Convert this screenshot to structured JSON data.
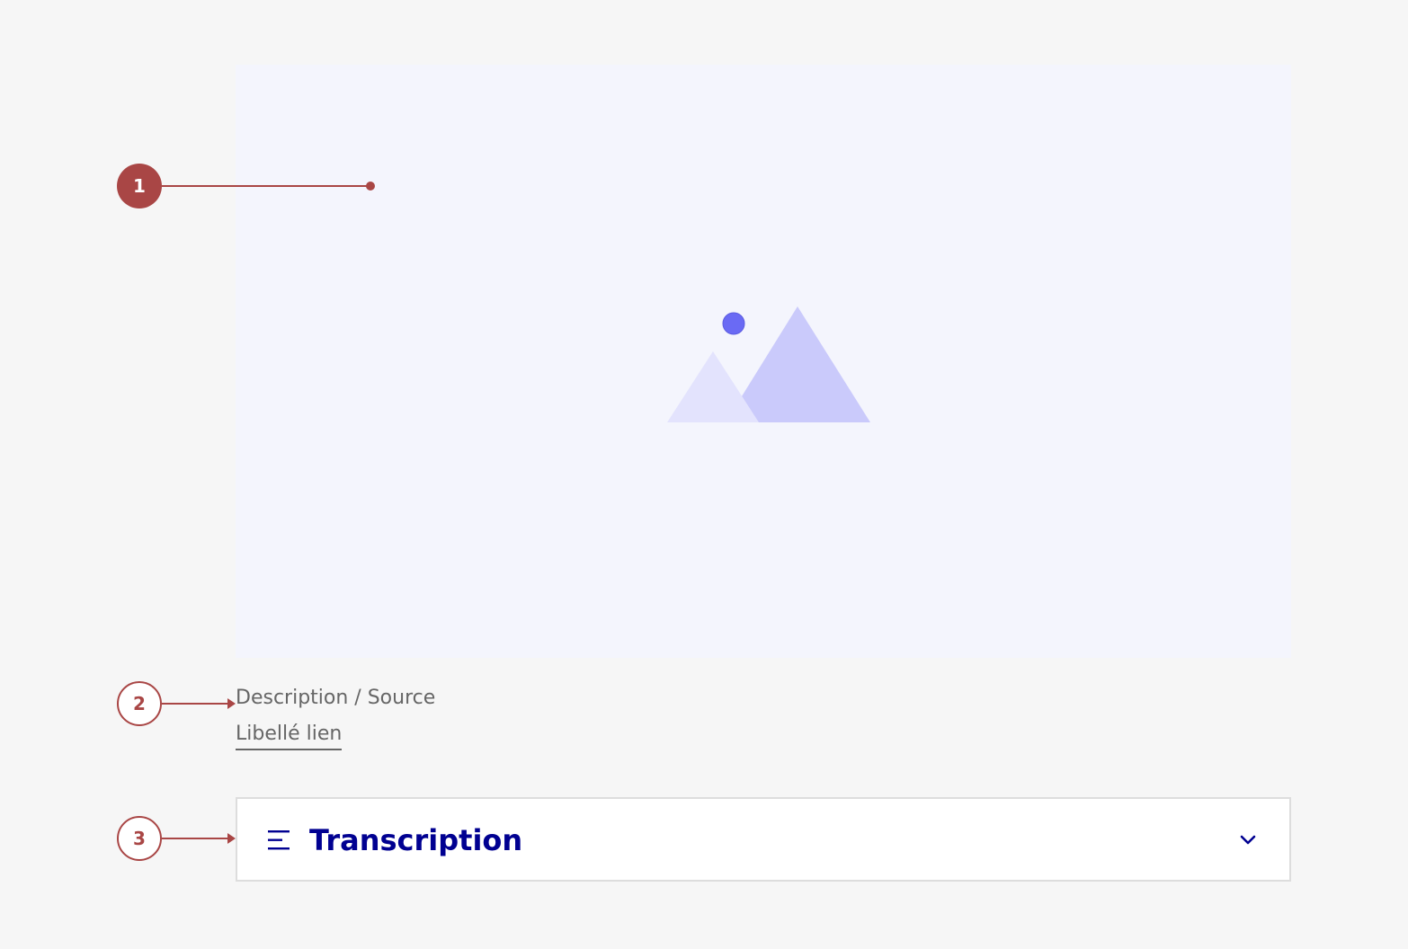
{
  "annotations": [
    {
      "number": "1",
      "style": "filled"
    },
    {
      "number": "2",
      "style": "outline"
    },
    {
      "number": "3",
      "style": "outline"
    }
  ],
  "media": {
    "placeholder_icon": "image-placeholder-icon",
    "background_color": "#f4f5fd",
    "sun_color": "#6a6af4",
    "mountain_front_color": "#cacafb",
    "mountain_back_color": "#e3e3fd"
  },
  "caption": {
    "text": "Description / Source",
    "link_label": "Libellé lien"
  },
  "transcription": {
    "icon": "list-icon",
    "title": "Transcription",
    "toggle_icon": "chevron-down-icon",
    "expanded": false
  },
  "colors": {
    "annotation": "#a94645",
    "accent": "#000091",
    "caption_text": "#666666"
  }
}
